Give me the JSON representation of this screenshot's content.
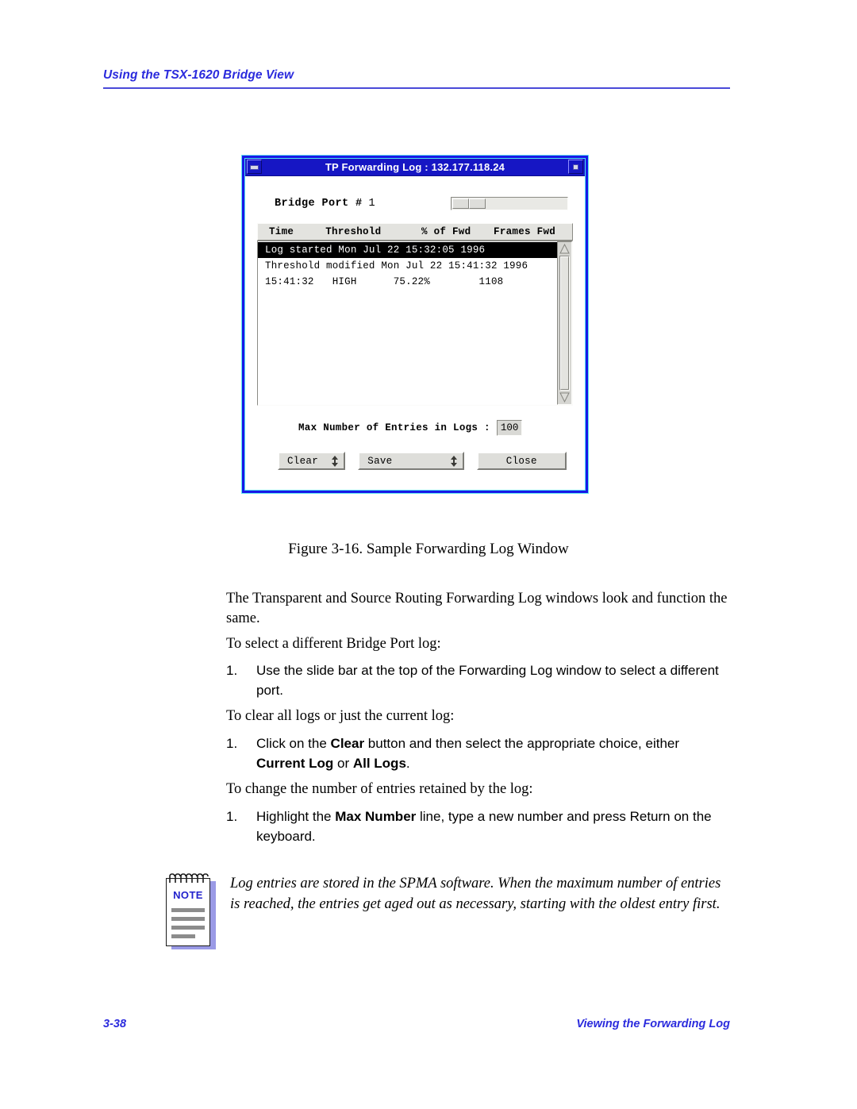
{
  "header": {
    "title": "Using the TSX-1620 Bridge View"
  },
  "figure": {
    "window": {
      "titlebar": {
        "title": "TP Forwarding Log : 132.177.118.24",
        "minimize_icon": "minimize-icon",
        "maximize_icon": "maximize-icon"
      },
      "port": {
        "label": "Bridge Port #",
        "value": "1",
        "slider_name": "bridge-port-slide-bar"
      },
      "columns": {
        "time": "Time",
        "threshold": "Threshold",
        "pct_of_fwd": "% of Fwd",
        "frames_fwd": "Frames Fwd"
      },
      "log_rows": [
        {
          "text": "Log started Mon Jul 22 15:32:05 1996",
          "selected": true
        },
        {
          "text": "Threshold modified Mon Jul 22 15:41:32 1996",
          "selected": false
        },
        {
          "text": "15:41:32   HIGH      75.22%        1108",
          "selected": false
        }
      ],
      "log_entries": [
        {
          "time": "15:41:32",
          "threshold": "HIGH",
          "pct_of_fwd": "75.22%",
          "frames_fwd": "1108"
        }
      ],
      "max_entries": {
        "label": "Max Number of Entries in Logs :",
        "value": "100"
      },
      "buttons": {
        "clear": "Clear",
        "save": "Save",
        "close": "Close"
      }
    },
    "caption": "Figure 3-16.  Sample Forwarding Log Window"
  },
  "body": {
    "para_intro": "The Transparent and Source Routing Forwarding Log windows look and function the same.",
    "para_select": "To select a different Bridge Port log:",
    "item_slide": {
      "num": "1.",
      "text": "Use the slide bar at the top of the Forwarding Log window to select a different port."
    },
    "para_clear": "To clear all logs or just the current log:",
    "item_clear": {
      "num": "1.",
      "part1": "Click on the ",
      "bold1": "Clear",
      "part2": " button and then select the appropriate choice, either ",
      "bold2": "Current Log",
      "part3": " or ",
      "bold3": "All Logs",
      "part4": "."
    },
    "para_entries": "To change the number of entries retained by the log:",
    "item_max": {
      "num": "1.",
      "part1": "Highlight the ",
      "bold1": "Max Number",
      "part2": " line, type a new number and press Return on the keyboard."
    }
  },
  "note": {
    "badge": "NOTE",
    "text": "Log entries are stored in the SPMA software. When the maximum number of entries is reached, the entries get aged out as necessary, starting with the oldest entry first."
  },
  "footer": {
    "page_number": "3-38",
    "section": "Viewing the Forwarding Log"
  },
  "colors": {
    "accent_blue": "#2b2bdd",
    "title_bar": "#1616c4",
    "window_border": "#1717e8",
    "note_blue": "#2323cc"
  }
}
